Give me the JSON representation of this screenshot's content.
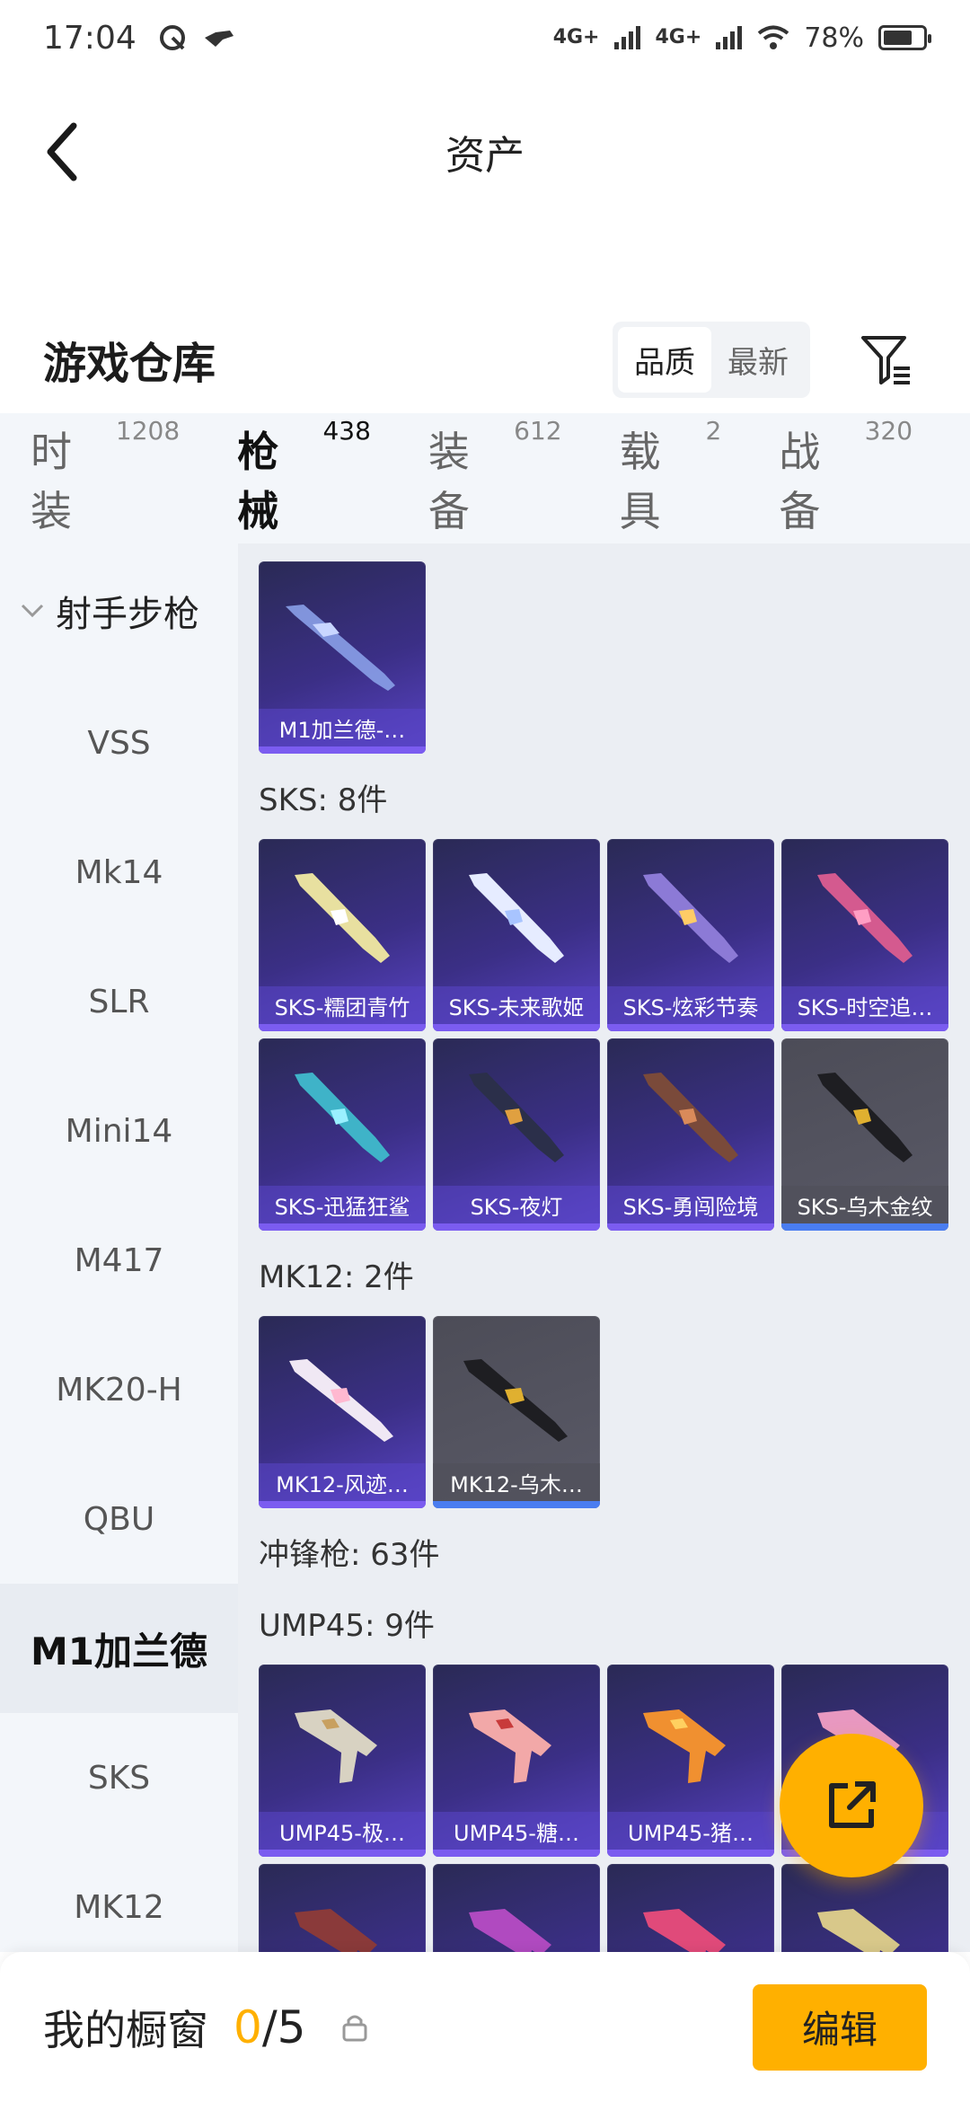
{
  "status_bar": {
    "time": "17:04",
    "signal_1": "4G+",
    "signal_2": "4G+",
    "battery_text": "78%",
    "battery_level": 0.78
  },
  "header": {
    "title": "资产"
  },
  "warehouse": {
    "title": "游戏仓库",
    "sort_quality": "品质",
    "sort_newest": "最新"
  },
  "tabs": [
    {
      "label": "时装",
      "count": "1208"
    },
    {
      "label": "枪械",
      "count": "438"
    },
    {
      "label": "装备",
      "count": "612"
    },
    {
      "label": "载具",
      "count": "2"
    },
    {
      "label": "战备",
      "count": "320"
    }
  ],
  "sidebar": {
    "category": "射手步枪",
    "items": [
      "VSS",
      "Mk14",
      "SLR",
      "Mini14",
      "M417",
      "MK20-H",
      "QBU",
      "M1加兰德",
      "SKS",
      "MK12"
    ]
  },
  "content": {
    "m1_cards": [
      {
        "name": "M1加兰德-…"
      }
    ],
    "sks_label": "SKS: 8件",
    "sks_cards": [
      {
        "name": "SKS-糯团青竹"
      },
      {
        "name": "SKS-未来歌姬"
      },
      {
        "name": "SKS-炫彩节奏"
      },
      {
        "name": "SKS-时空追…"
      },
      {
        "name": "SKS-迅猛狂鲨"
      },
      {
        "name": "SKS-夜灯"
      },
      {
        "name": "SKS-勇闯险境"
      },
      {
        "name": "SKS-乌木金纹"
      }
    ],
    "mk12_label": "MK12: 2件",
    "mk12_cards": [
      {
        "name": "MK12-风迹…"
      },
      {
        "name": "MK12-乌木…"
      }
    ],
    "smg_label": "冲锋枪: 63件",
    "ump_label": "UMP45: 9件",
    "ump_cards": [
      {
        "name": "UMP45-极…"
      },
      {
        "name": "UMP45-糖…"
      },
      {
        "name": "UMP45-猪…"
      },
      {
        "name": ""
      }
    ]
  },
  "bottom_bar": {
    "label": "我的橱窗",
    "current": "0",
    "total": "/5",
    "edit_label": "编辑"
  },
  "colors": {
    "accent": "#ffb000",
    "card_purple": "#3b2f86",
    "card_grey": "#55555f"
  }
}
